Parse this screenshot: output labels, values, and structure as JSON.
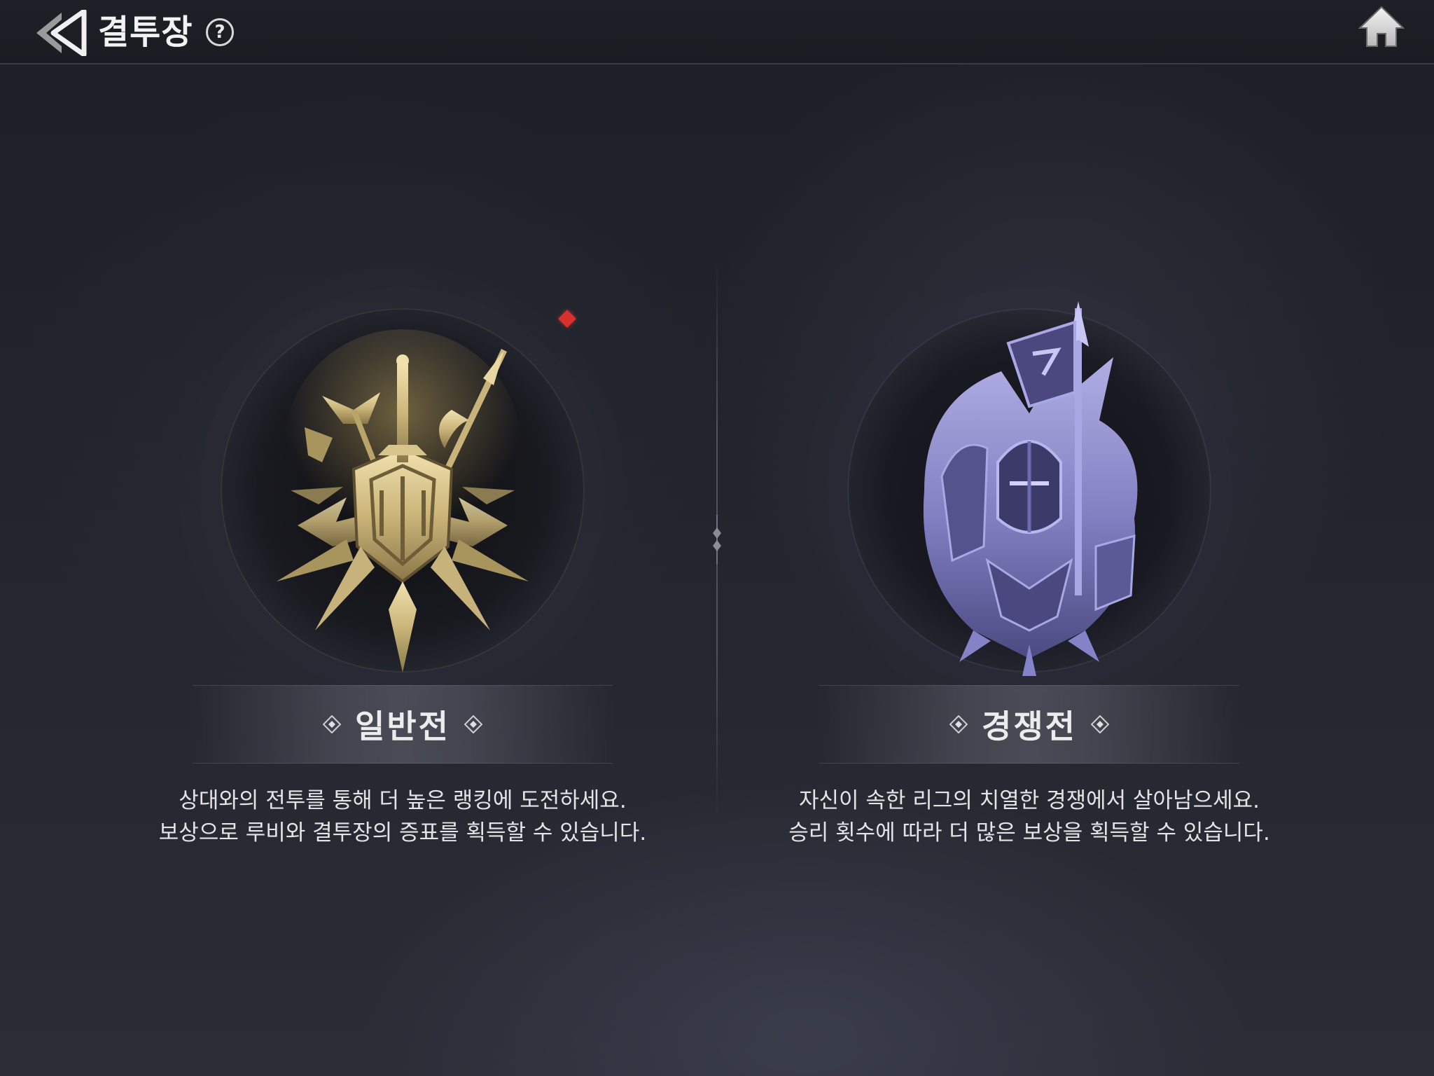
{
  "header": {
    "title": "결투장",
    "help_icon": "question-circle-icon",
    "help_glyph": "?",
    "back_icon": "double-arrow-back-icon",
    "home_icon": "home-icon"
  },
  "modes": [
    {
      "id": "normal",
      "title": "일반전",
      "emblem": "gold-sword-crest-emblem",
      "emblem_color": "#d9c68c",
      "has_notification": true,
      "notification_color": "#d8302c",
      "description_line1": "상대와의 전투를 통해 더 높은 랭킹에 도전하세요.",
      "description_line2": "보상으로 루비와 결투장의 증표를 획득할 수 있습니다."
    },
    {
      "id": "ranked",
      "title": "경쟁전",
      "emblem": "violet-knight-banner-emblem",
      "emblem_color": "#9b98d8",
      "has_notification": false,
      "description_line1": "자신이 속한 리그의 치열한 경쟁에서 살아남으세요.",
      "description_line2": "승리 횟수에 따라 더 많은 보상을 획득할 수 있습니다."
    }
  ]
}
